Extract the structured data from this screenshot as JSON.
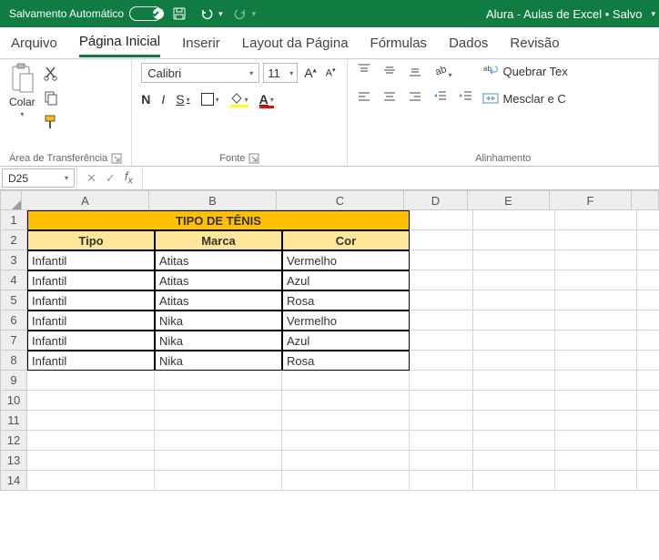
{
  "titlebar": {
    "autosave": "Salvamento Automático",
    "doc": "Alura - Aulas de Excel • Salvo"
  },
  "tabs": {
    "arquivo": "Arquivo",
    "pagina_inicial": "Página Inicial",
    "inserir": "Inserir",
    "layout": "Layout da Página",
    "formulas": "Fórmulas",
    "dados": "Dados",
    "revisao": "Revisão"
  },
  "ribbon": {
    "clipboard": {
      "paste": "Colar",
      "group": "Área de Transferência"
    },
    "font": {
      "name": "Calibri",
      "size": "11",
      "bold": "N",
      "italic": "I",
      "underline": "S",
      "group": "Fonte"
    },
    "alignment": {
      "wrap": "Quebrar Tex",
      "merge": "Mesclar e C",
      "group": "Alinhamento"
    }
  },
  "namebox": "D25",
  "formula": "",
  "columns": [
    "A",
    "B",
    "C",
    "D",
    "E",
    "F"
  ],
  "table": {
    "title": "TIPO DE TÊNIS",
    "headers": {
      "a": "Tipo",
      "b": "Marca",
      "c": "Cor"
    },
    "rows": [
      {
        "a": "Infantil",
        "b": "Atitas",
        "c": "Vermelho"
      },
      {
        "a": "Infantil",
        "b": "Atitas",
        "c": "Azul"
      },
      {
        "a": "Infantil",
        "b": "Atitas",
        "c": "Rosa"
      },
      {
        "a": "Infantil",
        "b": "Nika",
        "c": "Vermelho"
      },
      {
        "a": "Infantil",
        "b": "Nika",
        "c": "Azul"
      },
      {
        "a": "Infantil",
        "b": "Nika",
        "c": "Rosa"
      }
    ]
  }
}
